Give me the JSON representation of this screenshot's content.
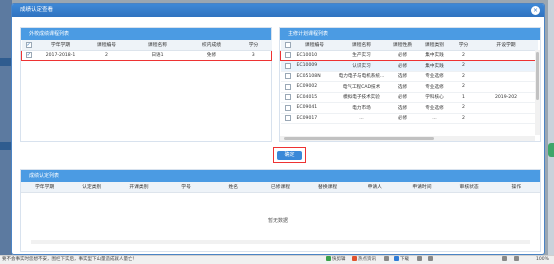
{
  "dialog": {
    "title": "成绩认定查看",
    "close_glyph": "×"
  },
  "left_panel": {
    "title": "外校成绩课程列表",
    "headers": [
      "学年学期",
      "课程编号",
      "课程名称",
      "校内成绩",
      "学分"
    ],
    "rows": [
      {
        "term": "2017-2018-1",
        "code": "2",
        "name": "日语1",
        "grade": "免修",
        "credit": "3",
        "checked": true
      }
    ]
  },
  "right_panel": {
    "title": "主修计划课程列表",
    "headers": [
      "课程编号",
      "课程名称",
      "课程性质",
      "课程类别",
      "学分",
      "开设学期"
    ],
    "rows": [
      {
        "code": "EC10010",
        "name": "生产实习",
        "nature": "必修",
        "category": "集中实践",
        "credit": "2",
        "term": ""
      },
      {
        "code": "EC10009",
        "name": "认识实习",
        "nature": "必修",
        "category": "集中实践",
        "credit": "2",
        "term": ""
      },
      {
        "code": "EC05108N",
        "name": "电力电子与电机系统...",
        "nature": "选修",
        "category": "专业选修",
        "credit": "2",
        "term": ""
      },
      {
        "code": "EC09002",
        "name": "电气工程CAD技术",
        "nature": "选修",
        "category": "专业选修",
        "credit": "2",
        "term": ""
      },
      {
        "code": "EC04015",
        "name": "模拟电子技术实验",
        "nature": "必修",
        "category": "学科核心",
        "credit": "1",
        "term": "2019-202"
      },
      {
        "code": "EC09041",
        "name": "电力市场",
        "nature": "选修",
        "category": "专业选修",
        "credit": "2",
        "term": ""
      },
      {
        "code": "EC09017",
        "name": "...",
        "nature": "必修",
        "category": "...",
        "credit": "2",
        "term": ""
      }
    ]
  },
  "confirm_button": "确定",
  "bottom_panel": {
    "title": "成绩认定列表",
    "headers": [
      "学年学期",
      "认定类别",
      "开课类别",
      "学号",
      "姓名",
      "已修课程",
      "替换课程",
      "申请人",
      "申请时间",
      "审核状态",
      "操作"
    ],
    "empty_text": "暂无数据"
  },
  "statusbar": {
    "left_text": "要不会事实时您想不安，围栏下实后，事实型下山量造成就人量亡！",
    "items": [
      "快剪辑",
      "热点资讯",
      "",
      "下载",
      "",
      "",
      ""
    ],
    "zoom": "100%"
  }
}
